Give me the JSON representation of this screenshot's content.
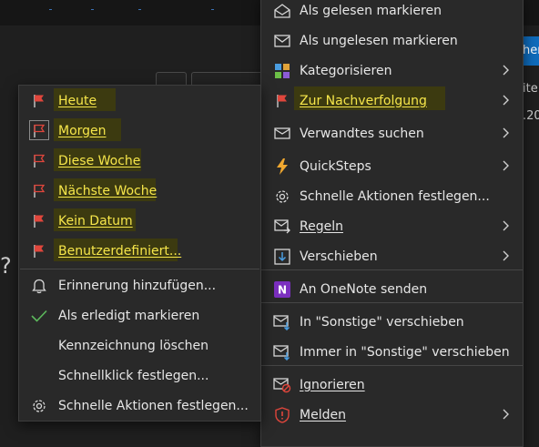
{
  "background": {
    "tab_fragments": [
      "her",
      "ite",
      ".20"
    ],
    "bullet": "?"
  },
  "right_menu": {
    "items": [
      {
        "id": "gelesen",
        "label": "Als gelesen markieren",
        "icon": "envelope-open-icon",
        "submenu": false
      },
      {
        "id": "ungelesen",
        "label": "Als ungelesen markieren",
        "icon": "envelope-icon",
        "submenu": false
      },
      {
        "id": "kategorisieren",
        "label": "Kategorisieren",
        "icon": "category-grid-icon",
        "submenu": true
      },
      {
        "id": "nachverfolgung",
        "label": "Zur Nachverfolgung",
        "icon": "red-flag-icon",
        "submenu": true,
        "highlighted": true
      },
      {
        "id": "verwandtes",
        "label": "Verwandtes suchen",
        "icon": "envelope-search-icon",
        "submenu": true
      },
      {
        "id": "quicksteps",
        "label": "QuickSteps",
        "icon": "lightning-icon",
        "submenu": true
      },
      {
        "id": "aktionen",
        "label": "Schnelle Aktionen festlegen...",
        "icon": "gear-icon",
        "submenu": false
      },
      {
        "id": "regeln",
        "label": "Regeln",
        "icon": "rules-icon",
        "submenu": true
      },
      {
        "id": "verschieben",
        "label": "Verschieben",
        "icon": "move-icon",
        "submenu": true
      },
      {
        "id": "onenote",
        "label": "An OneNote senden",
        "icon": "onenote-icon",
        "submenu": false
      },
      {
        "id": "sonstige",
        "label": "In \"Sonstige\" verschieben",
        "icon": "envelope-arrow-icon",
        "submenu": false
      },
      {
        "id": "immer-sonstige",
        "label": "Immer in \"Sonstige\" verschieben",
        "icon": "envelope-arrow-icon",
        "submenu": false
      },
      {
        "id": "ignorieren",
        "label": "Ignorieren",
        "icon": "ignore-icon",
        "submenu": false
      },
      {
        "id": "melden",
        "label": "Melden",
        "icon": "shield-report-icon",
        "submenu": true
      }
    ]
  },
  "left_menu": {
    "items": [
      {
        "id": "heute",
        "label": "Heute",
        "icon": "red-flag-icon",
        "highlighted": true
      },
      {
        "id": "morgen",
        "label": "Morgen",
        "icon": "red-flag-icon",
        "highlighted": true,
        "selected": true
      },
      {
        "id": "diese-woche",
        "label": "Diese Woche",
        "icon": "red-flag-icon",
        "highlighted": true
      },
      {
        "id": "naechste-woche",
        "label": "Nächste Woche",
        "icon": "red-flag-icon",
        "highlighted": true
      },
      {
        "id": "kein-datum",
        "label": "Kein Datum",
        "icon": "red-flag-icon",
        "highlighted": true
      },
      {
        "id": "benutzerdefiniert",
        "label": "Benutzerdefiniert...",
        "icon": "red-flag-icon",
        "highlighted": true
      },
      {
        "id": "erinnerung",
        "label": "Erinnerung hinzufügen...",
        "icon": "bell-icon"
      },
      {
        "id": "erledigt",
        "label": "Als erledigt markieren",
        "icon": "checkmark-icon"
      },
      {
        "id": "loeschen",
        "label": "Kennzeichnung löschen",
        "icon": ""
      },
      {
        "id": "schnellklick",
        "label": "Schnellklick festlegen...",
        "icon": ""
      },
      {
        "id": "aktionen",
        "label": "Schnelle Aktionen festlegen...",
        "icon": "gear-icon"
      }
    ]
  },
  "colors": {
    "highlight_text": "#f6e64a",
    "highlight_bg": "#3c3a10",
    "flag_red": "#e0463c",
    "menu_bg": "#292929",
    "accent_blue": "#0f6cbd"
  }
}
